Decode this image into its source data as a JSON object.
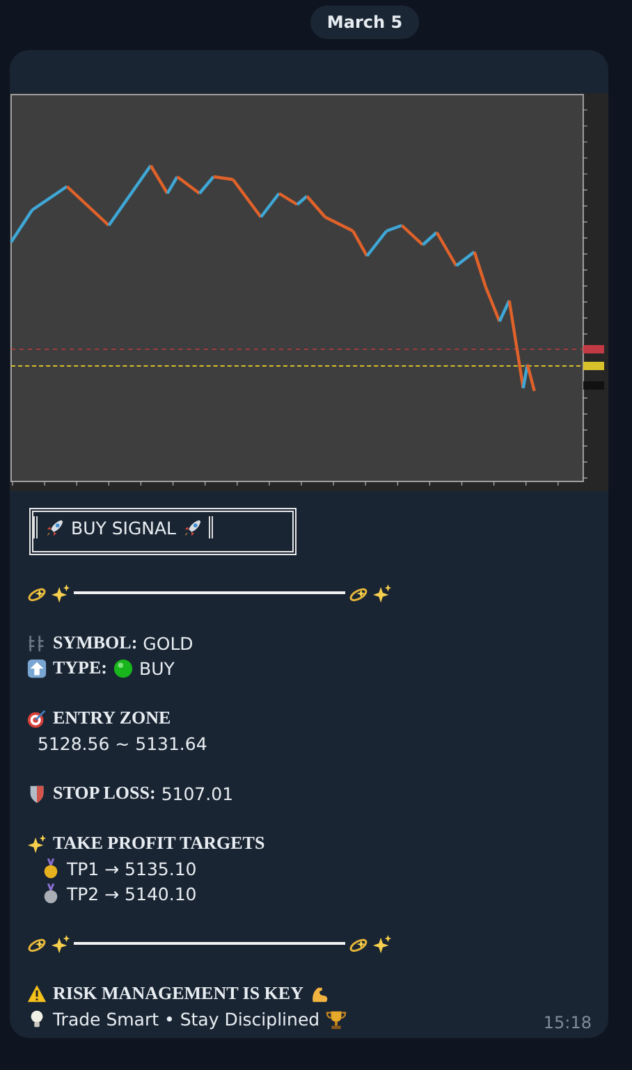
{
  "date": "March 5",
  "message": {
    "title": "BUY SIGNAL",
    "symbol": {
      "label": "SYMBOL:",
      "value": "GOLD"
    },
    "type": {
      "label": "TYPE:",
      "value": "BUY"
    },
    "entry": {
      "heading": "ENTRY ZONE",
      "value": "5128.56 ~ 5131.64"
    },
    "stop_loss": {
      "label": "STOP LOSS:",
      "value": "5107.01"
    },
    "targets": {
      "heading": "TAKE PROFIT TARGETS",
      "items": [
        {
          "text": "TP1 → 5135.10"
        },
        {
          "text": "TP2 → 5140.10"
        }
      ]
    },
    "risk": "RISK MANAGEMENT IS KEY",
    "motto": "Trade Smart • Stay Disciplined",
    "time": "15:18"
  }
}
